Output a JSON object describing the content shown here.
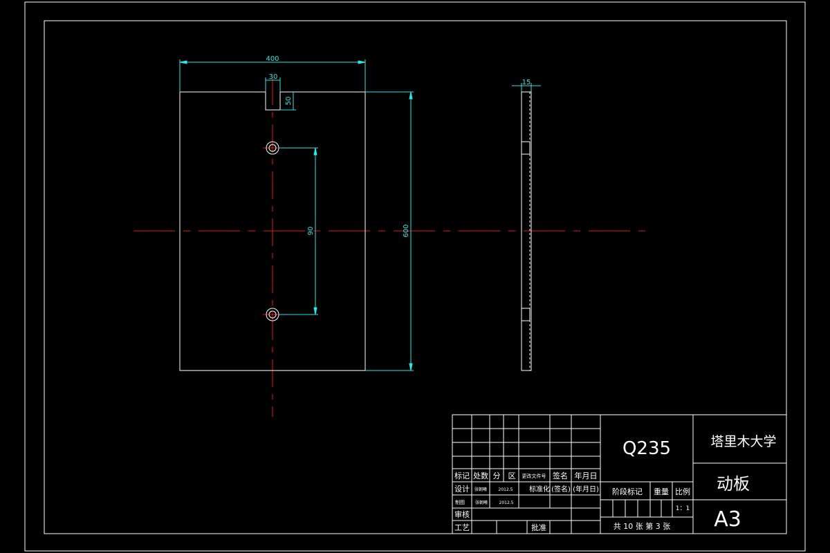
{
  "drawing": {
    "dims": {
      "width": "400",
      "slot_width": "30",
      "slot_depth": "50",
      "height": "600",
      "hole_spacing": "90",
      "thickness": "15"
    }
  },
  "title_block": {
    "material": "Q235",
    "school": "塔里木大学",
    "part_name": "动板",
    "sheet_size": "A3",
    "header_row": [
      "标记",
      "处数",
      "分",
      "区",
      "更改文件号",
      "签名",
      "年月日"
    ],
    "design_label": "设计",
    "design_name": "张朝曦",
    "design_date": "2012.5",
    "standard_label": "标准化",
    "signature_label": "(签名)",
    "date_label": "(年月日)",
    "drawing_label": "制图",
    "drawing_name": "张朝曦",
    "drawing_date": "2012.5",
    "review_label": "审核",
    "process_label": "工艺",
    "approve_label": "批准",
    "stage_mark_label": "阶段标记",
    "weight_label": "重量",
    "scale_label": "比例",
    "scale_value": "1：1",
    "sheets_text": "共 10 张 第 3 张"
  },
  "colors": {
    "outline": "#ffffff",
    "dimension": "#2ee6e6",
    "centerline": "#e01818",
    "background": "#000000"
  }
}
